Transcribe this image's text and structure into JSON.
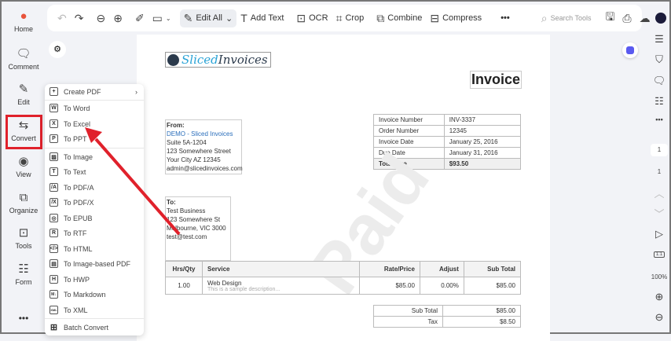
{
  "toolbar": {
    "edit_all": "Edit All",
    "add_text": "Add Text",
    "ocr": "OCR",
    "crop": "Crop",
    "combine": "Combine",
    "compress": "Compress",
    "search_placeholder": "Search Tools"
  },
  "sidebar": {
    "items": [
      {
        "label": "Home"
      },
      {
        "label": "Comment"
      },
      {
        "label": "Edit"
      },
      {
        "label": "Convert"
      },
      {
        "label": "View"
      },
      {
        "label": "Organize"
      },
      {
        "label": "Tools"
      },
      {
        "label": "Form"
      }
    ]
  },
  "convert_menu": {
    "items": [
      "Create PDF",
      "To Word",
      "To Excel",
      "To PPT",
      "To Image",
      "To Text",
      "To PDF/A",
      "To PDF/X",
      "To EPUB",
      "To RTF",
      "To HTML",
      "To Image-based PDF",
      "To HWP",
      "To Markdown",
      "To XML",
      "Batch Convert"
    ],
    "icons": [
      "+",
      "W",
      "X",
      "P",
      "▨",
      "T",
      "/A",
      "/X",
      "◎",
      "R",
      "</>",
      "▤",
      "H",
      "M↓",
      "XML",
      "⊞"
    ]
  },
  "right_panel": {
    "page_input": "1",
    "page_total": "1",
    "zoom": "100%",
    "fit_label": "1:1"
  },
  "document": {
    "logo_a": "Sliced",
    "logo_b": "Invoices",
    "title": "Invoice",
    "from": {
      "label": "From:",
      "name": "DEMO - Sliced Invoices",
      "lines": [
        "Suite 5A-1204",
        "123 Somewhere Street",
        "Your City AZ 12345",
        "admin@slicedinvoices.com"
      ]
    },
    "to": {
      "label": "To:",
      "lines": [
        "Test Business",
        "123 Somewhere St",
        "Melbourne, VIC 3000",
        "test@test.com"
      ]
    },
    "info": [
      [
        "Invoice Number",
        "INV-3337"
      ],
      [
        "Order Number",
        "12345"
      ],
      [
        "Invoice Date",
        "January 25, 2016"
      ],
      [
        "Due Date",
        "January 31, 2016"
      ],
      [
        "Total Due",
        "$93.50"
      ]
    ],
    "items_header": [
      "Hrs/Qty",
      "Service",
      "Rate/Price",
      "Adjust",
      "Sub Total"
    ],
    "item": {
      "qty": "1.00",
      "service": "Web Design",
      "desc": "This is a sample description...",
      "rate": "$85.00",
      "adjust": "0.00%",
      "subtotal": "$85.00"
    },
    "totals": [
      [
        "Sub Total",
        "$85.00"
      ],
      [
        "Tax",
        "$8.50"
      ]
    ],
    "watermark": "Paid"
  },
  "colors": {
    "accent": "#e0212b",
    "link": "#2a6ebb"
  }
}
